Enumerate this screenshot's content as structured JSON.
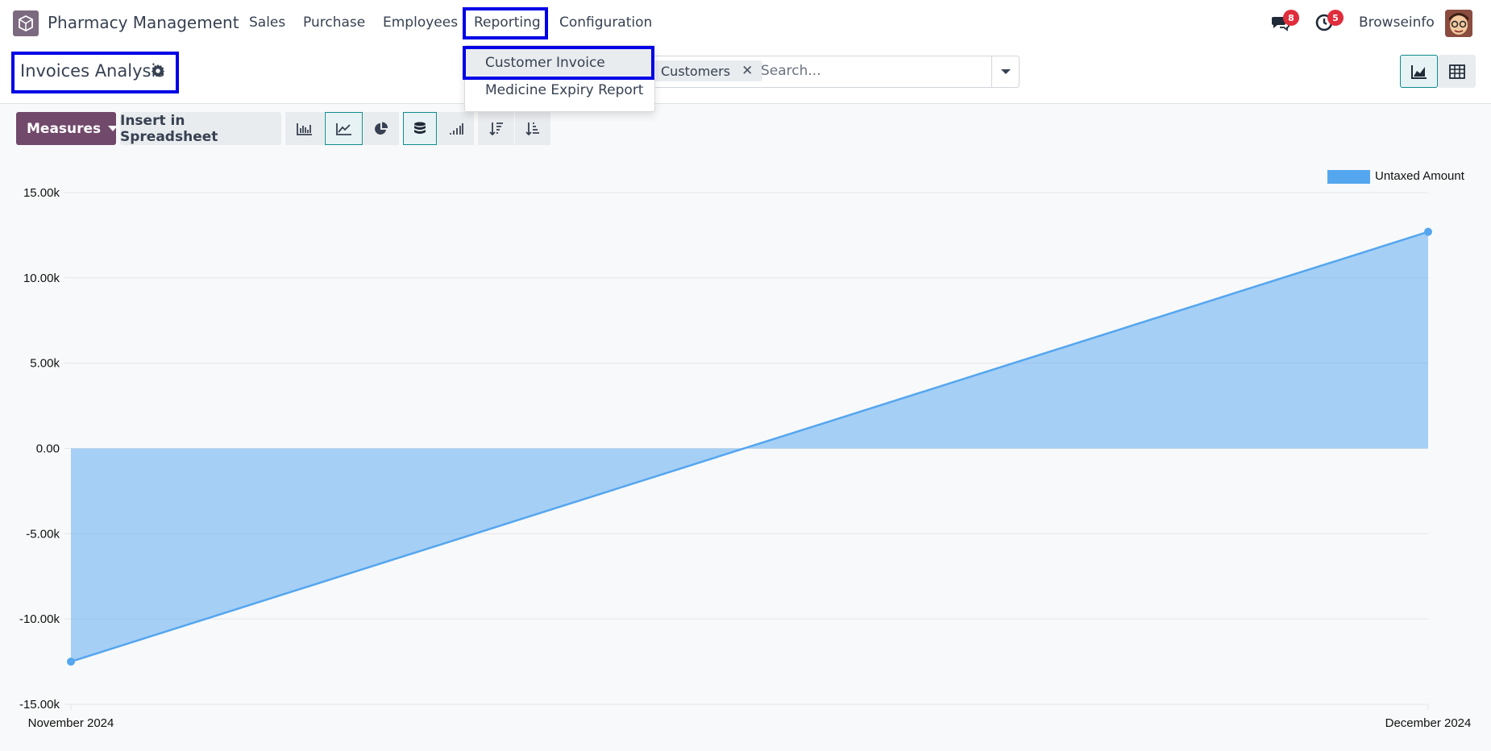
{
  "navbar": {
    "app_name": "Pharmacy Management",
    "menu": [
      "Sales",
      "Purchase",
      "Employees",
      "Reporting",
      "Configuration"
    ],
    "messages_count": "8",
    "activities_count": "5",
    "user_name": "Browseinfo"
  },
  "dropdown": {
    "items": [
      "Customer Invoice",
      "Medicine Expiry Report"
    ]
  },
  "control_panel": {
    "title": "Invoices Analysis",
    "facet": "Customers",
    "search_placeholder": "Search..."
  },
  "toolbar": {
    "measures_label": "Measures",
    "spreadsheet_label": "Insert in Spreadsheet"
  },
  "colors": {
    "brand": "#71496b",
    "highlight_box": "#0000e6",
    "series": "#54a6ef",
    "active_teal": "#0f8b8d"
  },
  "chart_data": {
    "type": "area",
    "x": [
      "November 2024",
      "December 2024"
    ],
    "series": [
      {
        "name": "Untaxed Amount",
        "values": [
          -12500,
          12700
        ]
      }
    ],
    "ylim": [
      -15000,
      15000
    ],
    "yticks": [
      "15.00k",
      "10.00k",
      "5.00k",
      "0.00",
      "-5.00k",
      "-10.00k",
      "-15.00k"
    ],
    "grid": true,
    "legend": "top-right"
  }
}
